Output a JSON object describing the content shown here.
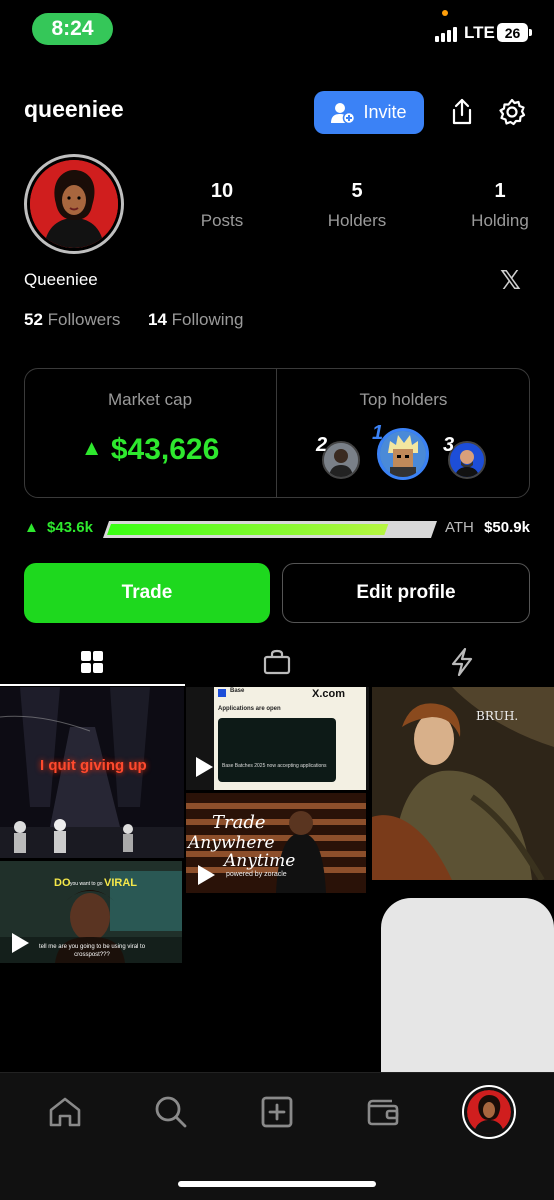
{
  "status_bar": {
    "time": "8:24",
    "network": "LTE",
    "battery": "26"
  },
  "header": {
    "username": "queeniee",
    "invite_label": "Invite"
  },
  "stats": [
    {
      "value": "10",
      "label": "Posts"
    },
    {
      "value": "5",
      "label": "Holders"
    },
    {
      "value": "1",
      "label": "Holding"
    }
  ],
  "profile": {
    "display_name": "Queeniee",
    "followers_count": "52",
    "followers_label": "Followers",
    "following_count": "14",
    "following_label": "Following"
  },
  "market": {
    "market_cap_label": "Market cap",
    "market_cap_value": "$43,626",
    "top_holders_label": "Top holders",
    "holders": [
      {
        "rank": "2"
      },
      {
        "rank": "1"
      },
      {
        "rank": "3"
      }
    ]
  },
  "progress": {
    "current": "$43.6k",
    "ath_label": "ATH",
    "ath_value": "$50.9k",
    "fraction": 0.856
  },
  "actions": {
    "trade_label": "Trade",
    "edit_label": "Edit profile"
  },
  "tabs": [
    {
      "icon": "grid-icon",
      "active": true
    },
    {
      "icon": "shopping-bag-icon",
      "active": false
    },
    {
      "icon": "lightning-icon",
      "active": false
    }
  ],
  "posts": {
    "concert_text": "I quit giving up",
    "base_card_brand": "Base",
    "base_card_site": "X.com",
    "base_card_title": "Applications are open",
    "base_card_caption": "Base Batches 2025 now accepting applications",
    "trade_line1": "Trade",
    "trade_line2": "Anywhere",
    "trade_line3": "Anytime",
    "trade_powered": "powered by zoracle",
    "viral_do": "DO",
    "viral_small": "you want to go",
    "viral_word": "VIRAL",
    "viral_caption": "tell me are you going to be using viral to crosspost???",
    "painting_text": "BRUH."
  },
  "nav": {
    "items": [
      "home-icon",
      "search-icon",
      "create-icon",
      "wallet-icon",
      "profile-avatar"
    ]
  },
  "colors": {
    "accent_green": "#2ee82e",
    "trade_button": "#1ed81e",
    "invite_blue": "#3b82f6",
    "status_pill": "#35c759"
  }
}
